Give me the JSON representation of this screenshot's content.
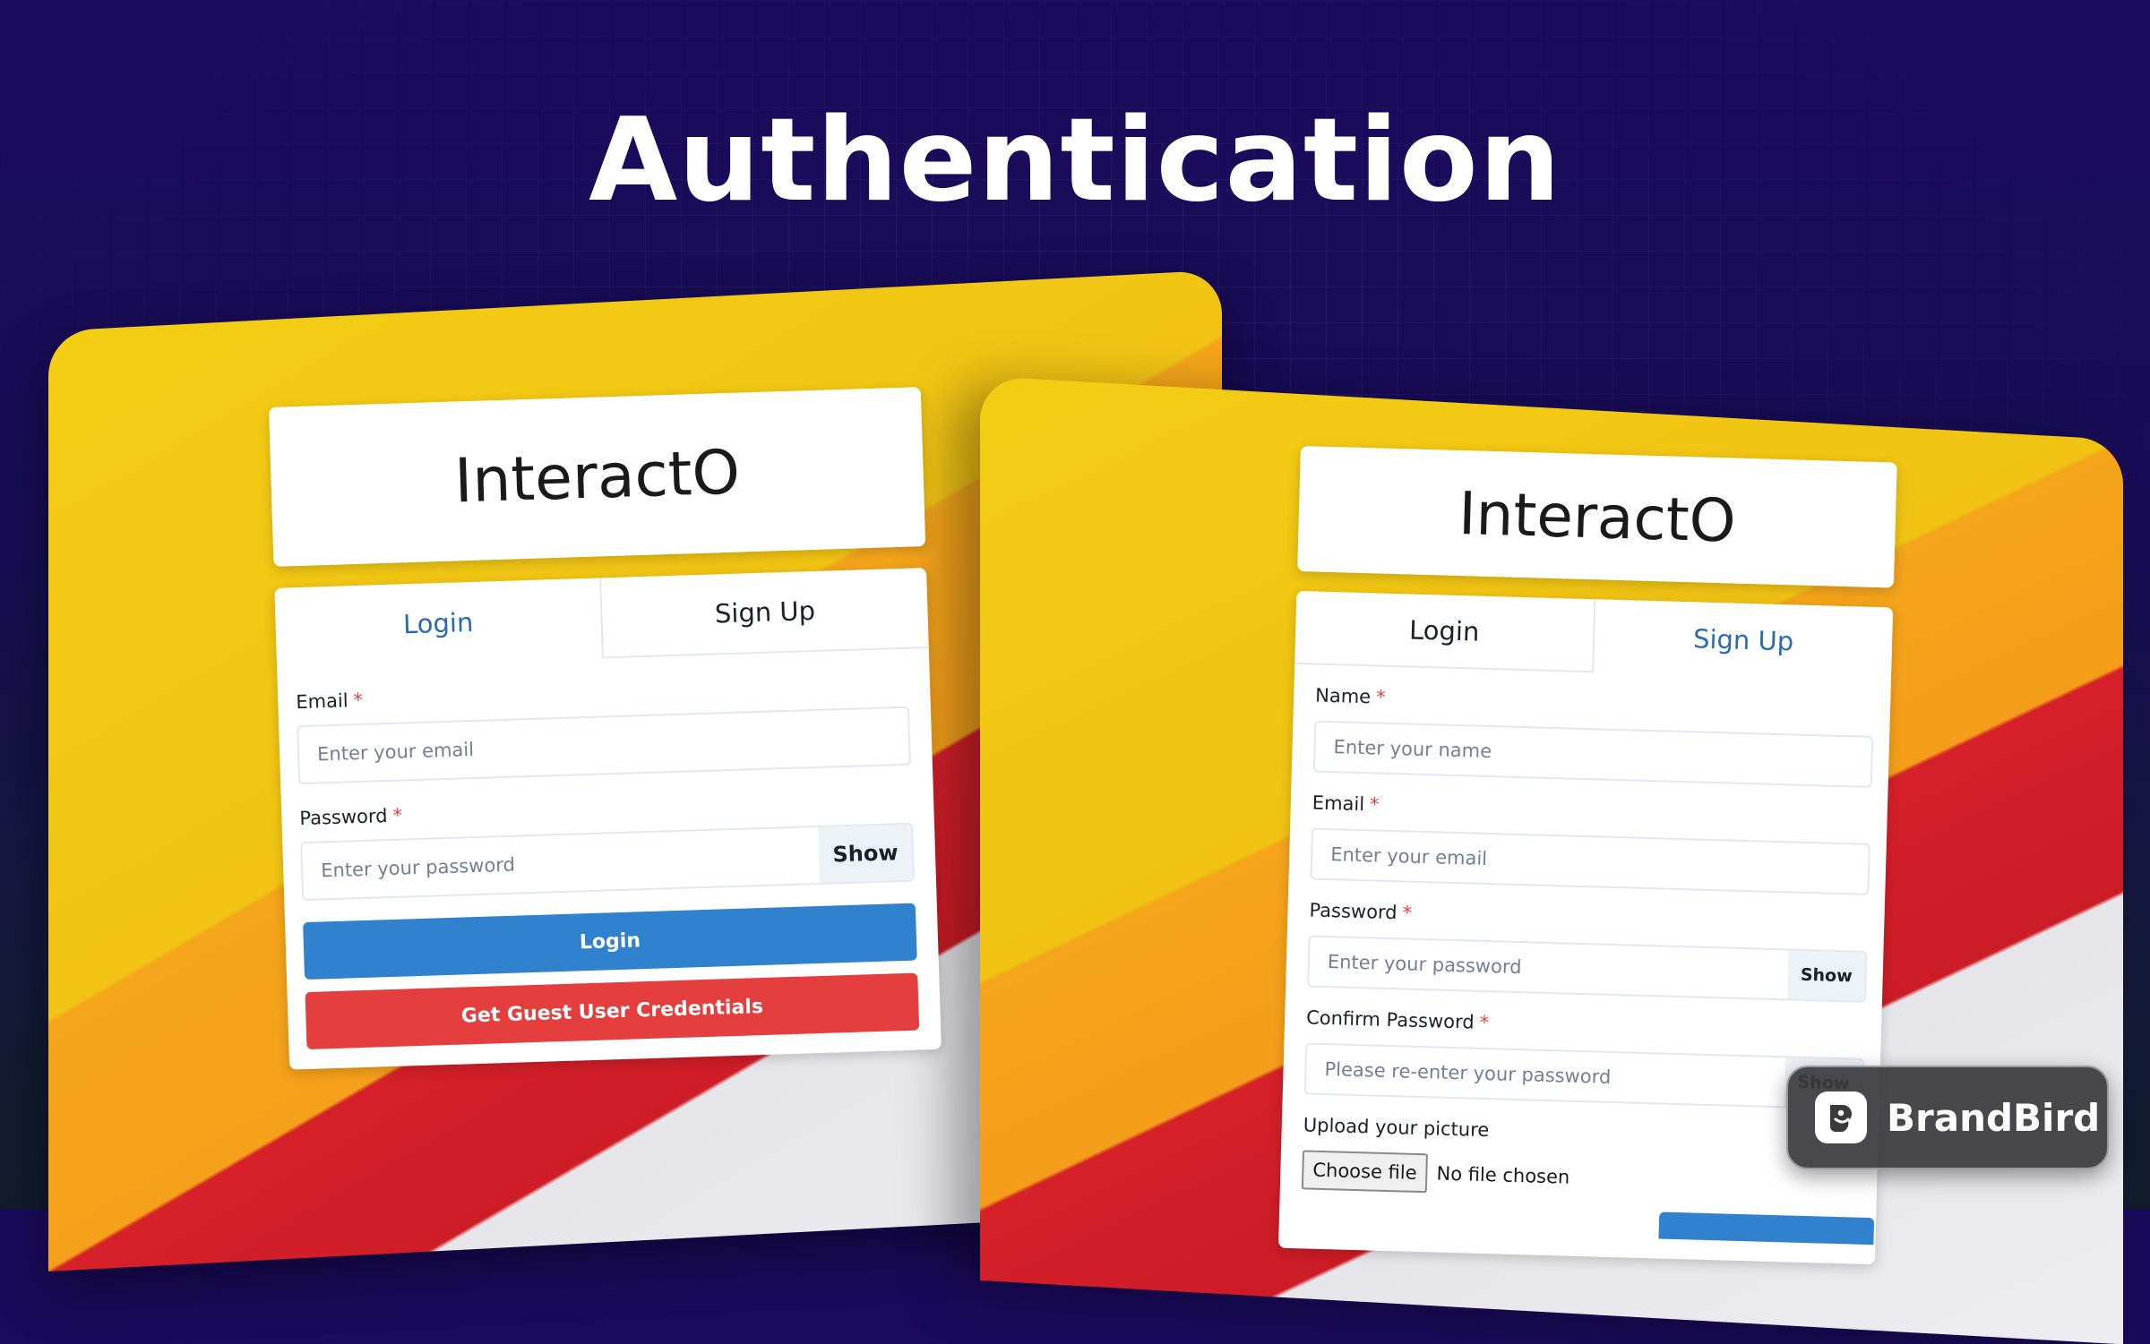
{
  "headline": "Authentication",
  "login_app": {
    "brand": "InteractO",
    "tabs": {
      "login": "Login",
      "signup": "Sign Up"
    },
    "email": {
      "label": "Email",
      "required": "*",
      "placeholder": "Enter your email"
    },
    "password": {
      "label": "Password",
      "required": "*",
      "placeholder": "Enter your password",
      "toggle": "Show"
    },
    "login_button": "Login",
    "guest_button": "Get Guest User Credentials"
  },
  "signup_app": {
    "brand": "InteractO",
    "tabs": {
      "login": "Login",
      "signup": "Sign Up"
    },
    "name": {
      "label": "Name",
      "required": "*",
      "placeholder": "Enter your name"
    },
    "email": {
      "label": "Email",
      "required": "*",
      "placeholder": "Enter your email"
    },
    "password": {
      "label": "Password",
      "required": "*",
      "placeholder": "Enter your password",
      "toggle": "Show"
    },
    "confirm_password": {
      "label": "Confirm Password",
      "required": "*",
      "placeholder": "Please re-enter your password",
      "toggle": "Show"
    },
    "picture": {
      "label": "Upload your picture",
      "button": "Choose file",
      "status": "No file chosen"
    }
  },
  "badge": {
    "name": "BrandBird",
    "icon": "brandbird-logo-icon"
  },
  "colors": {
    "primary_blue": "#3182ce",
    "danger_red": "#e53e3e",
    "active_tab": "#2b6cb0",
    "stripe_yellow": "#f3cd14",
    "stripe_orange": "#f4a51a",
    "stripe_red": "#d6202a"
  }
}
